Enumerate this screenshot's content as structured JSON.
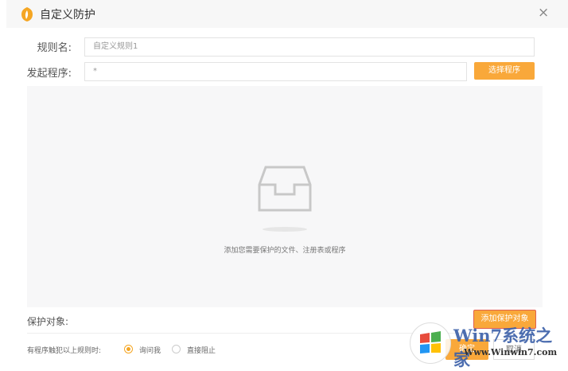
{
  "window": {
    "title": "自定义防护",
    "close": "×"
  },
  "form": {
    "rule_name_label": "规则名:",
    "rule_name_value": "自定义规则1",
    "program_label": "发起程序:",
    "program_value": "*",
    "select_program": "选择程序"
  },
  "empty_state": {
    "hint": "添加您需要保护的文件、注册表或程序"
  },
  "protect": {
    "label": "保护对象:",
    "add_button": "添加保护对象"
  },
  "policy": {
    "label": "有程序触犯以上规则时:",
    "options": [
      {
        "label": "询问我",
        "selected": true
      },
      {
        "label": "直接阻止",
        "selected": false
      }
    ]
  },
  "footer": {
    "confirm": "确定",
    "cancel": "取消"
  },
  "watermark": {
    "brand": "Win7系统之家",
    "url": "Www.Winwin7.com"
  },
  "colors": {
    "accent": "#f9a83a"
  }
}
